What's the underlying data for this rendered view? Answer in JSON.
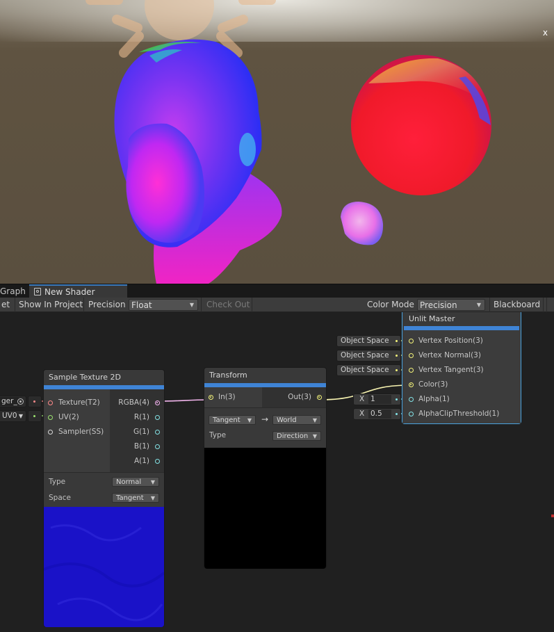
{
  "scene": {
    "close_label": "x"
  },
  "tabs": [
    {
      "label": "Graph"
    },
    {
      "label": "New Shader Graph"
    }
  ],
  "toolbar": {
    "save_label": "et",
    "show_in_project_label": "Show In Project",
    "precision_label": "Precision",
    "precision_value": "Float",
    "check_out_label": "Check Out",
    "color_mode_label": "Color Mode",
    "color_mode_value": "Precision",
    "blackboard_label": "Blackboard"
  },
  "left_inputs": {
    "texture_field": "ger_",
    "uv_value": "UV0"
  },
  "sample_texture": {
    "title": "Sample Texture 2D",
    "inputs": [
      "Texture(T2)",
      "UV(2)",
      "Sampler(SS)"
    ],
    "outputs": [
      "RGBA(4)",
      "R(1)",
      "G(1)",
      "B(1)",
      "A(1)"
    ],
    "type_label": "Type",
    "type_value": "Normal",
    "space_label": "Space",
    "space_value": "Tangent"
  },
  "transform": {
    "title": "Transform",
    "input": "In(3)",
    "output": "Out(3)",
    "from_value": "Tangent",
    "arrow": "→",
    "to_value": "World",
    "type_label": "Type",
    "type_value": "Direction"
  },
  "master": {
    "title": "Unlit Master",
    "inputs": [
      "Vertex Position(3)",
      "Vertex Normal(3)",
      "Vertex Tangent(3)",
      "Color(3)",
      "Alpha(1)",
      "AlphaClipThreshold(1)"
    ],
    "space_fields": [
      "Object Space",
      "Object Space",
      "Object Space"
    ],
    "alpha": {
      "label": "X",
      "value": "1"
    },
    "alpha_clip": {
      "label": "X",
      "value": "0.5"
    }
  },
  "colors": {
    "accent_blue": "#3f84d6",
    "port_texture": "#ff8a8a",
    "port_uv": "#9be36f",
    "port_vector4": "#f6b4f2",
    "port_vector3": "#f4f47a",
    "port_vector1": "#84e4e7",
    "wire_color": "#f7f3b0",
    "preview_normal": "#1a10c8"
  }
}
